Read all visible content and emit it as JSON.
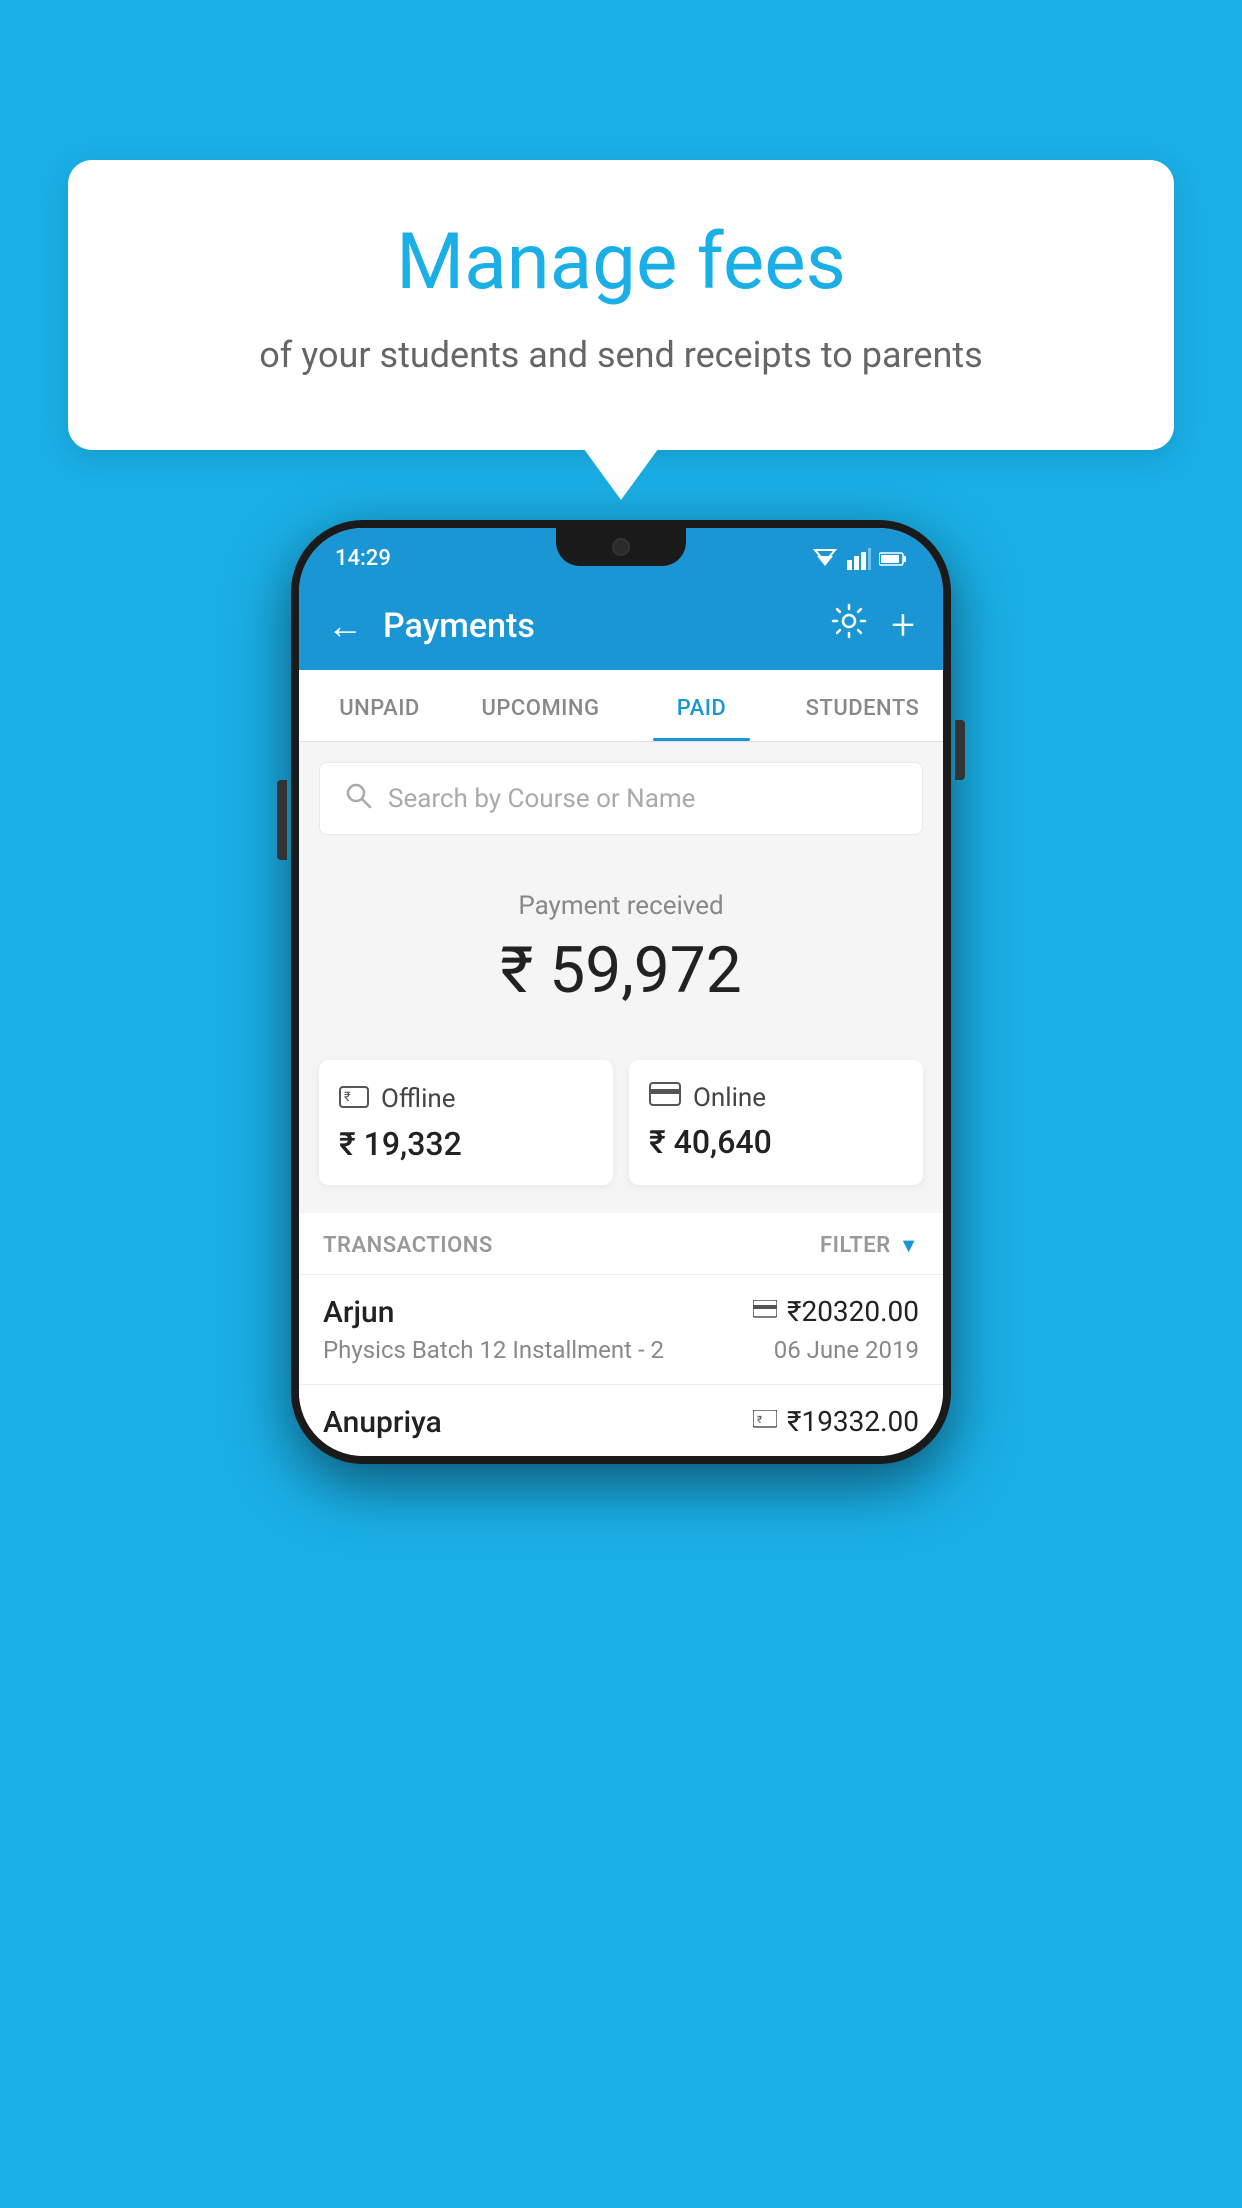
{
  "background_color": "#1AAFE6",
  "tooltip": {
    "title": "Manage fees",
    "subtitle": "of your students and send receipts to parents"
  },
  "status_bar": {
    "time": "14:29",
    "wifi": "▼",
    "signal": "▲",
    "battery": "▓"
  },
  "header": {
    "back_label": "←",
    "title": "Payments",
    "gear_label": "⚙",
    "plus_label": "+"
  },
  "tabs": [
    {
      "id": "unpaid",
      "label": "UNPAID",
      "active": false
    },
    {
      "id": "upcoming",
      "label": "UPCOMING",
      "active": false
    },
    {
      "id": "paid",
      "label": "PAID",
      "active": true
    },
    {
      "id": "students",
      "label": "STUDENTS",
      "active": false
    }
  ],
  "search": {
    "placeholder": "Search by Course or Name"
  },
  "payment_received": {
    "label": "Payment received",
    "amount": "₹ 59,972"
  },
  "offline_card": {
    "icon": "₹",
    "label": "Offline",
    "amount": "₹ 19,332"
  },
  "online_card": {
    "icon": "▬",
    "label": "Online",
    "amount": "₹ 40,640"
  },
  "transactions_section": {
    "label": "TRANSACTIONS",
    "filter_label": "FILTER"
  },
  "transactions": [
    {
      "name": "Arjun",
      "amount": "₹20320.00",
      "payment_type": "card",
      "course": "Physics Batch 12 Installment - 2",
      "date": "06 June 2019"
    },
    {
      "name": "Anupriya",
      "amount": "₹19332.00",
      "payment_type": "cash",
      "course": "",
      "date": ""
    }
  ]
}
